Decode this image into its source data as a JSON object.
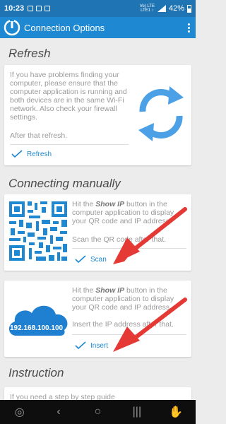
{
  "status": {
    "time": "10:23",
    "network": "Vo) LTE\nLTE1 ↕",
    "battery": "42%"
  },
  "appbar": {
    "title": "Connection Options"
  },
  "refresh": {
    "title": "Refresh",
    "text": "If you have problems finding your computer, please ensure that the computer application is running and both devices are in the same Wi-Fi network. Also check your firewall settings.",
    "text2": "After that refresh.",
    "button": "Refresh"
  },
  "manual": {
    "title": "Connecting manually",
    "scan_pre": "Hit the ",
    "scan_bold": "Show IP",
    "scan_post": " button in the computer application to display your QR code and IP address.",
    "scan_text2": "Scan the QR code after that.",
    "scan_button": "Scan",
    "ip_pre": "Hit the ",
    "ip_bold": "Show IP",
    "ip_post": " button in the computer application to display your QR code and IP address.",
    "ip_text2": "Insert the IP address after that.",
    "ip_button": "Insert",
    "ip_address": "192.168.100.100"
  },
  "instruction": {
    "title": "Instruction",
    "text": "If you need a step by step guide"
  },
  "colors": {
    "accent": "#1e88d2",
    "statusbar": "#1f74b3",
    "arrow": "#e53935"
  }
}
